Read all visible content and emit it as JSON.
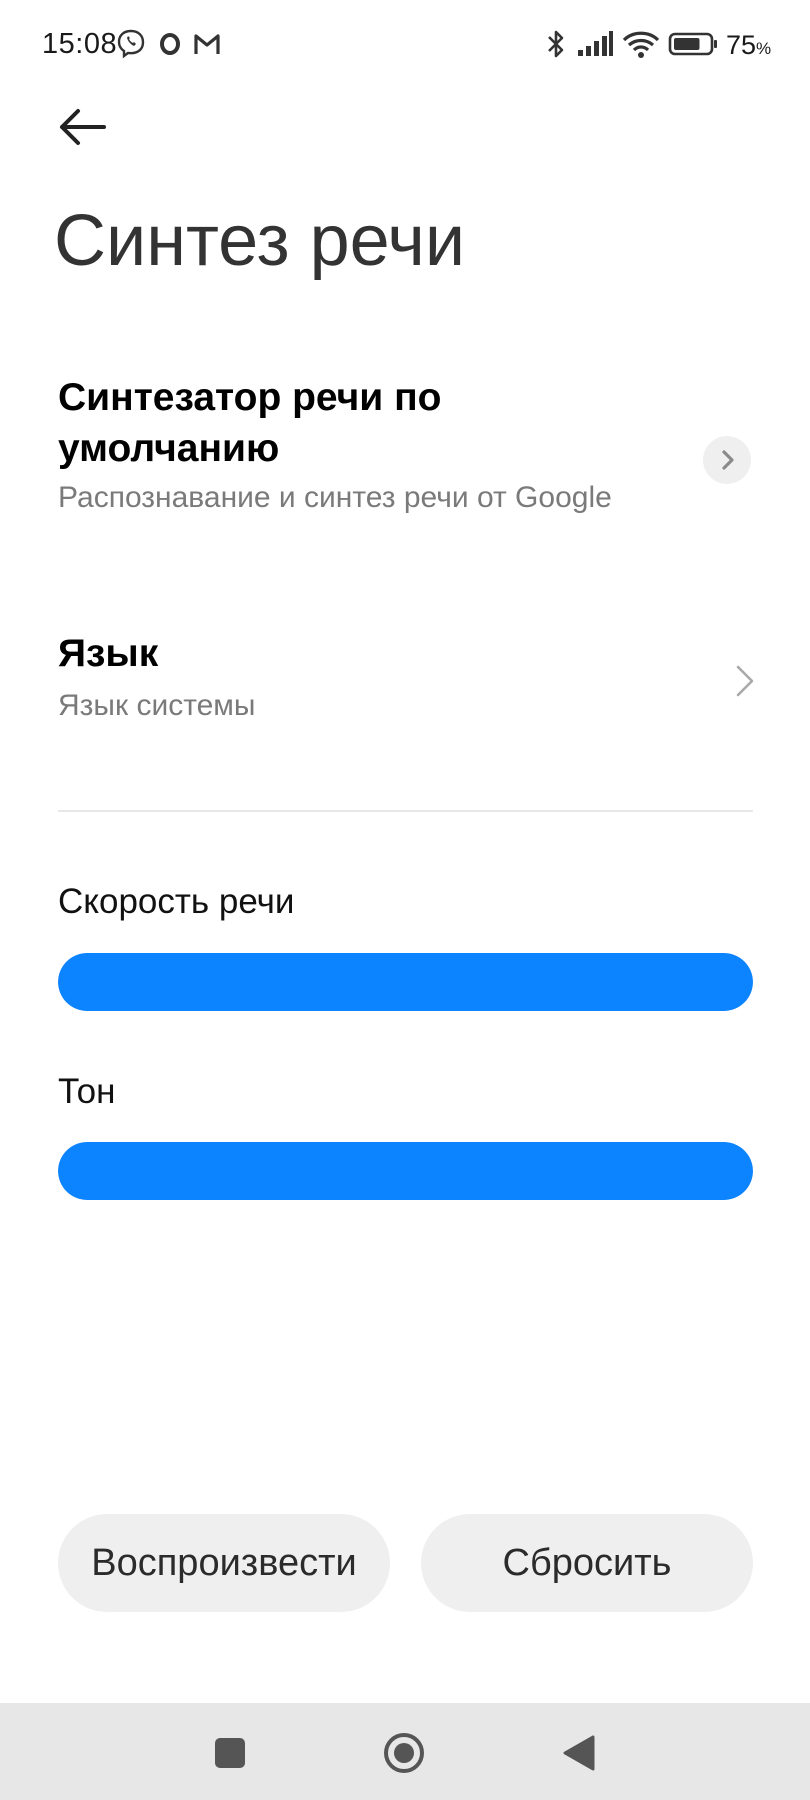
{
  "status_bar": {
    "time": "15:08",
    "battery_percent": "75",
    "battery_unit": "%",
    "battery_level": 0.75,
    "notification_icons": [
      "viber-icon",
      "opera-icon",
      "gmail-icon"
    ],
    "system_icons": [
      "bluetooth-icon",
      "signal-icon",
      "wifi-icon",
      "battery-icon"
    ]
  },
  "header": {
    "title": "Синтез речи"
  },
  "settings": {
    "default_engine": {
      "title": "Синтезатор речи по умолчанию",
      "subtitle": "Распознавание и синтез речи от Google"
    },
    "language": {
      "title": "Язык",
      "subtitle": "Язык системы"
    }
  },
  "sliders": {
    "speech_rate": {
      "label": "Скорость речи",
      "value": 1.0
    },
    "pitch": {
      "label": "Тон",
      "value": 1.0
    }
  },
  "actions": {
    "play_label": "Воспроизвести",
    "reset_label": "Сбросить"
  },
  "colors": {
    "accent": "#0d84ff",
    "subtitle": "#7a7a7a",
    "button_bg": "#efefef",
    "nav_bg": "#e7e7e7"
  }
}
